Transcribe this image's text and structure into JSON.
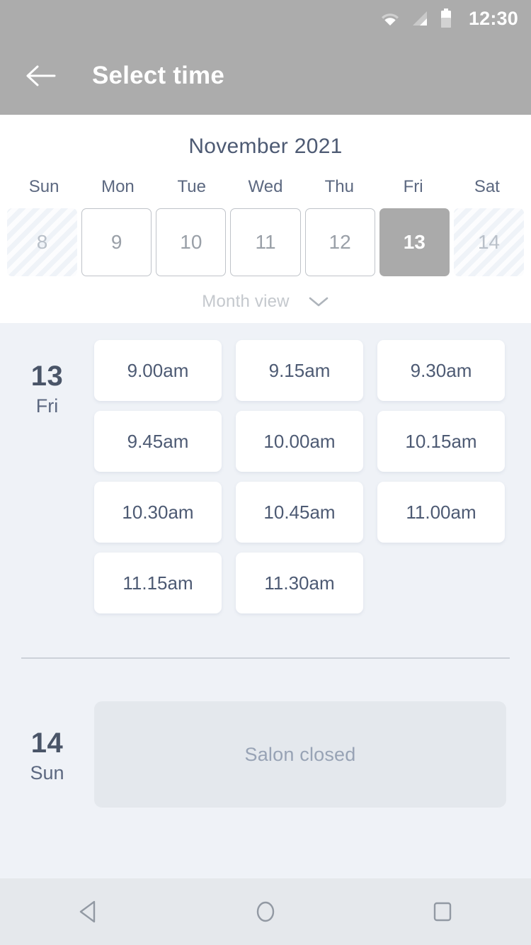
{
  "status_bar": {
    "time": "12:30",
    "icons": [
      "wifi-icon",
      "signal-icon",
      "battery-icon"
    ]
  },
  "app_bar": {
    "back_icon": "arrow-left-icon",
    "title": "Select time"
  },
  "calendar": {
    "month_label": "November 2021",
    "weekdays": [
      "Sun",
      "Mon",
      "Tue",
      "Wed",
      "Thu",
      "Fri",
      "Sat"
    ],
    "days": [
      {
        "num": "8",
        "state": "disabled"
      },
      {
        "num": "9",
        "state": "available"
      },
      {
        "num": "10",
        "state": "available"
      },
      {
        "num": "11",
        "state": "available"
      },
      {
        "num": "12",
        "state": "available"
      },
      {
        "num": "13",
        "state": "selected"
      },
      {
        "num": "14",
        "state": "disabled"
      }
    ],
    "view_toggle_label": "Month view",
    "view_toggle_icon": "chevron-down-icon"
  },
  "schedule": [
    {
      "date_num": "13",
      "day_of_week": "Fri",
      "slots": [
        "9.00am",
        "9.15am",
        "9.30am",
        "9.45am",
        "10.00am",
        "10.15am",
        "10.30am",
        "10.45am",
        "11.00am",
        "11.15am",
        "11.30am"
      ]
    },
    {
      "date_num": "14",
      "day_of_week": "Sun",
      "closed_message": "Salon closed"
    }
  ],
  "nav_bar": {
    "back_label": "back-icon",
    "home_label": "home-icon",
    "recents_label": "recents-icon"
  },
  "colors": {
    "app_bar": "#acacac",
    "selected_day": "#aaaaaa",
    "body_bg": "#eff2f7",
    "text_primary": "#4d5a73",
    "closed_panel": "#e4e8ed"
  }
}
